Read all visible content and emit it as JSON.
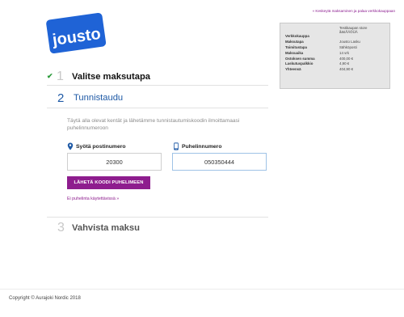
{
  "brand": {
    "logo_text": "jousto",
    "logo_color": "#1f63d6"
  },
  "header": {
    "cancel_link": "« Keskeytä maksaminen ja palaa verkkokauppaan"
  },
  "summary": {
    "rows": [
      {
        "key": "",
        "value": "Testikaupan store\nåäöÅÄÖÜÄ"
      },
      {
        "key": "Verkkokauppa",
        "value": ""
      },
      {
        "key": "Maksutapa",
        "value": "Jousto Lasku"
      },
      {
        "key": "Toimitustapa",
        "value": "Sähköposti"
      },
      {
        "key": "Maksuaika",
        "value": "14 vrk"
      },
      {
        "key": "Ostoksen summa",
        "value": "400,00 €"
      },
      {
        "key": "Laskutuspalkkio",
        "value": "4,90 €"
      },
      {
        "key": "Yhteensä",
        "value": "404,90 €"
      }
    ]
  },
  "steps": {
    "step1": {
      "number": "1",
      "title": "Valitse maksutapa",
      "check": "✔"
    },
    "step2": {
      "number": "2",
      "title": "Tunnistaudu",
      "instructions": "Täytä alla olevat kentät ja lähetämme tunnistautumiskoodin ilmoittamaasi puhelinnumeroon",
      "postal_label": "Syötä postinumero",
      "postal_value": "20300",
      "phone_label": "Puhelinnumero",
      "phone_value": "050350444",
      "send_button": "LÄHETÄ KOODI PUHELIMEEN",
      "no_phone_link": "Ei puhelinta käytettävissä »"
    },
    "step3": {
      "number": "3",
      "title": "Vahvista maksu"
    }
  },
  "footer": {
    "copyright": "Copyright © Aurajoki Nordic 2018"
  },
  "colors": {
    "accent": "#8e1d8e",
    "step_active": "#1f5aa6",
    "check": "#2a9a3a"
  }
}
